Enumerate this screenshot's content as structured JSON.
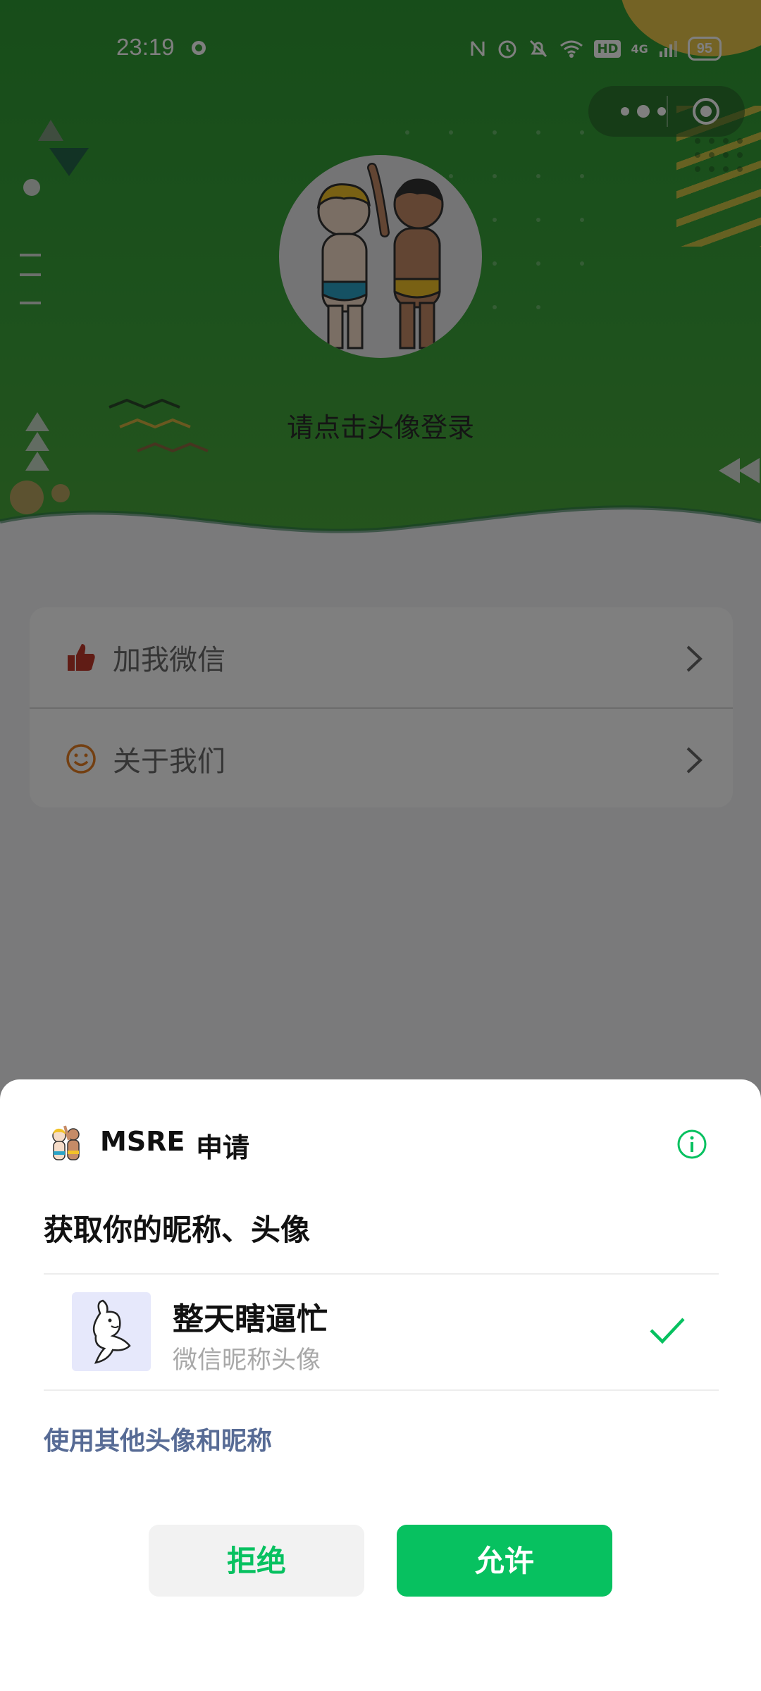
{
  "status_bar": {
    "time": "23:19",
    "battery": "95",
    "network": "4G",
    "hd": "HD"
  },
  "page": {
    "login_tip": "请点击头像登录",
    "menu": [
      {
        "label": "加我微信",
        "icon": "thumbs-up-icon",
        "color": "#c0392b"
      },
      {
        "label": "关于我们",
        "icon": "smile-icon",
        "color": "#e67e22"
      }
    ]
  },
  "sheet": {
    "app_name": "MSRE",
    "apply": "申请",
    "title": "获取你的昵称、头像",
    "nickname": "整天瞎逼忙",
    "nickname_sub": "微信昵称头像",
    "other_option": "使用其他头像和昵称",
    "reject_label": "拒绝",
    "allow_label": "允许"
  },
  "colors": {
    "brand_green": "#07c160",
    "link_blue": "#576b95",
    "hero_green": "#3aa33a"
  }
}
